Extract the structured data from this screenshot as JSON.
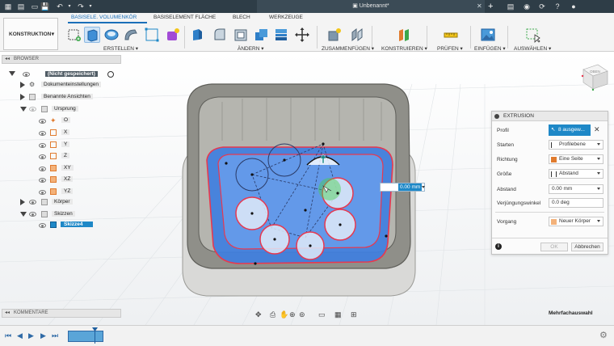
{
  "window": {
    "document_title": "Unbenannt*"
  },
  "ribbon": {
    "workspace": "KONSTRUKTION",
    "tabs": [
      "BASISELE. VOLUMENKÖR",
      "BASISELEMENT FLÄCHE",
      "BLECH",
      "WERKZEUGE"
    ],
    "groups": [
      "ERSTELLEN",
      "ÄNDERN",
      "ZUSAMMENFÜGEN",
      "KONSTRUIEREN",
      "PRÜFEN",
      "EINFÜGEN",
      "AUSWÄHLEN"
    ]
  },
  "browser": {
    "title": "BROWSER",
    "items": [
      {
        "label": "(Nicht gespeichert)"
      },
      {
        "label": "Dokumenteinstellungen"
      },
      {
        "label": "Benannte Ansichten"
      },
      {
        "label": "Ursprung"
      },
      {
        "label": "O"
      },
      {
        "label": "X"
      },
      {
        "label": "Y"
      },
      {
        "label": "Z"
      },
      {
        "label": "XY"
      },
      {
        "label": "XZ"
      },
      {
        "label": "YZ"
      },
      {
        "label": "Körper"
      },
      {
        "label": "Skizzen"
      },
      {
        "label": "Skizze4"
      }
    ]
  },
  "viewcube": {
    "face": "OBEN"
  },
  "extrusion": {
    "title": "EXTRUSION",
    "rows": {
      "profil": {
        "label": "Profil",
        "value": "8 ausgew..."
      },
      "starten": {
        "label": "Starten",
        "value": "Profilebene"
      },
      "richtung": {
        "label": "Richtung",
        "value": "Eine Seite"
      },
      "groesse": {
        "label": "Größe",
        "value": "Abstand"
      },
      "abstand": {
        "label": "Abstand",
        "value": "0.00 mm"
      },
      "verjuengung": {
        "label": "Verjüngungswinkel",
        "value": "0.0 deg"
      },
      "vorgang": {
        "label": "Vorgang",
        "value": "Neuer Körper"
      }
    },
    "ok": "OK",
    "cancel": "Abbrechen",
    "info": "i"
  },
  "canvas": {
    "distance_input": "0.00 mm"
  },
  "bottom": {
    "comments": "KOMMENTARE",
    "status": "Mehrfachauswahl"
  },
  "colors": {
    "accent": "#1e88c7",
    "profile_fill": "#3f7fe0",
    "selection_red": "#e8384f",
    "titlebar": "#2e3d47"
  }
}
